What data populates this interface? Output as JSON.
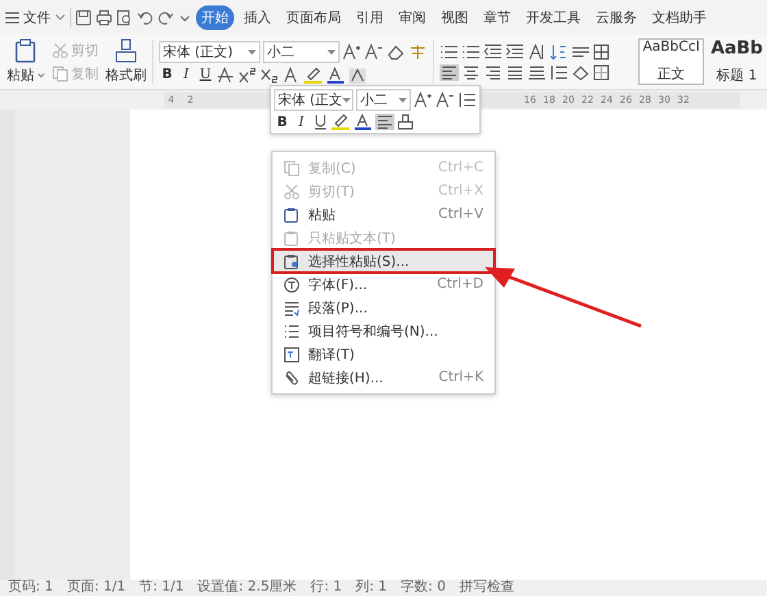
{
  "menu_bar": {
    "file_menu": "文件",
    "tabs": [
      {
        "label": "开始",
        "selected": true
      },
      {
        "label": "插入",
        "selected": false
      },
      {
        "label": "页面布局",
        "selected": false
      },
      {
        "label": "引用",
        "selected": false
      },
      {
        "label": "审阅",
        "selected": false
      },
      {
        "label": "视图",
        "selected": false
      },
      {
        "label": "章节",
        "selected": false
      },
      {
        "label": "开发工具",
        "selected": false
      },
      {
        "label": "云服务",
        "selected": false
      },
      {
        "label": "文档助手",
        "selected": false
      }
    ]
  },
  "ribbon": {
    "paste": "粘贴",
    "cut": {
      "label": "剪切",
      "disabled": true
    },
    "copy": {
      "label": "复制",
      "disabled": true
    },
    "format_painter": "格式刷",
    "font": "宋体 (正文)",
    "size": "小二",
    "format_letters": [
      "B",
      "I",
      "U"
    ],
    "styles": [
      {
        "sample": "AaBbCcI",
        "name": "正文",
        "selected": true
      },
      {
        "sample": "AaBb",
        "name": "标题 1",
        "selected": false
      }
    ]
  },
  "ruler": {
    "left_labels": [
      "4",
      "2"
    ],
    "right_labels": [
      "16",
      "18",
      "20",
      "22",
      "24",
      "26",
      "28",
      "30",
      "32"
    ]
  },
  "mini_toolbar": {
    "font": "宋体 (正文",
    "size": "小二",
    "format_letters": [
      "B",
      "I"
    ]
  },
  "context_menu": [
    {
      "kind": "copy",
      "label": "复制(C)",
      "shortcut": "Ctrl+C",
      "disabled": true,
      "selected": false
    },
    {
      "kind": "cut",
      "label": "剪切(T)",
      "shortcut": "Ctrl+X",
      "disabled": true,
      "selected": false
    },
    {
      "kind": "paste",
      "label": "粘贴",
      "shortcut": "Ctrl+V",
      "disabled": false,
      "selected": false
    },
    {
      "kind": "paste-text",
      "label": "只粘贴文本(T)",
      "disabled": true,
      "selected": false
    },
    {
      "kind": "paste-special",
      "label": "选择性粘贴(S)...",
      "disabled": false,
      "selected": true
    },
    {
      "kind": "font",
      "label": "字体(F)...",
      "shortcut": "Ctrl+D",
      "disabled": false,
      "selected": false
    },
    {
      "kind": "paragraph",
      "label": "段落(P)...",
      "disabled": false,
      "selected": false
    },
    {
      "kind": "bullets",
      "label": "项目符号和编号(N)...",
      "disabled": false,
      "selected": false
    },
    {
      "kind": "translate",
      "label": "翻译(T)",
      "disabled": false,
      "selected": false
    },
    {
      "kind": "link",
      "label": "超链接(H)...",
      "shortcut": "Ctrl+K",
      "disabled": false,
      "selected": false
    }
  ],
  "status_bar": [
    "页码: 1",
    "页面: 1/1",
    "节: 1/1",
    "设置值: 2.5厘米",
    "行: 1",
    "列: 1",
    "字数: 0",
    "拼写检查"
  ]
}
